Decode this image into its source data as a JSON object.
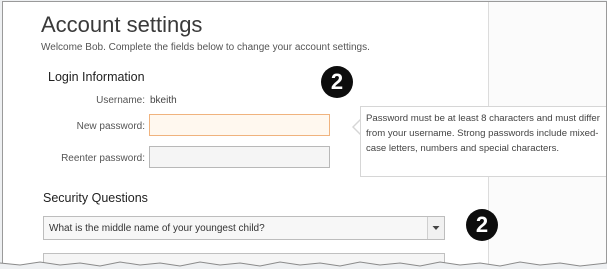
{
  "page": {
    "title": "Account settings",
    "welcome": "Welcome Bob. Complete the fields below to change your account settings."
  },
  "login": {
    "heading": "Login Information",
    "username_label": "Username:",
    "username_value": "bkeith",
    "new_password_label": "New password:",
    "new_password_value": "",
    "reenter_password_label": "Reenter password:",
    "reenter_password_value": ""
  },
  "tooltip": {
    "text": "Password must be at least 8 characters and must differ from your username. Strong passwords include mixed-case letters, numbers and special characters."
  },
  "badges": {
    "first": "2",
    "second": "2"
  },
  "security": {
    "heading": "Security Questions",
    "question_selected": "What is the middle name of your youngest child?",
    "answer_value": ""
  },
  "colors": {
    "focus_border": "#f0b37e",
    "badge_bg": "#0d0d0d"
  }
}
